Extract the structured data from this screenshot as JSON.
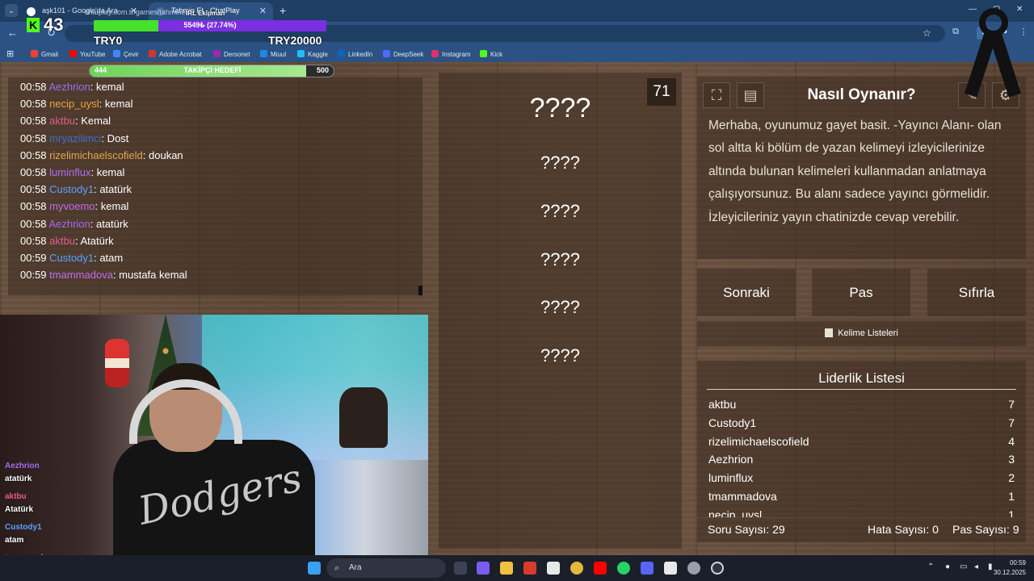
{
  "browser": {
    "tabs": [
      {
        "label": "aşk101 - Google'da Ara"
      },
      {
        "label": "Tahmin Et - ChatPlay"
      }
    ],
    "url": "chatplay.com.tr/games/tahminet",
    "bookmarks": [
      {
        "label": "Gmail",
        "color": "#ea4335"
      },
      {
        "label": "YouTube",
        "color": "#ff0000"
      },
      {
        "label": "Çevir",
        "color": "#4285f4"
      },
      {
        "label": "Adobe Acrobat",
        "color": "#d8322f"
      },
      {
        "label": "Dersonet",
        "color": "#9c27b0"
      },
      {
        "label": "Miuul",
        "color": "#1e88e5"
      },
      {
        "label": "Kaggle",
        "color": "#20beff"
      },
      {
        "label": "LinkedIn",
        "color": "#0a66c2"
      },
      {
        "label": "DeepSeek",
        "color": "#4d6bfe"
      },
      {
        "label": "Instagram",
        "color": "#e1306c"
      },
      {
        "label": "Kick",
        "color": "#53fc18"
      }
    ]
  },
  "stream": {
    "viewers": "43",
    "try_left": "TRY0",
    "try_right": "TRY20000",
    "goal_label": "5549₺ (27.74%)",
    "goal_fraction": 0.2774,
    "team_label": "IRL Ekipman",
    "follow_goal": {
      "current": "444",
      "label": "TAKİPÇİ HEDEFİ",
      "target": "500",
      "fraction": 0.888
    }
  },
  "chat": [
    {
      "time": "00:58",
      "user": "Aezhrion",
      "color": "#a36bf0",
      "msg": ": kemal"
    },
    {
      "time": "00:58",
      "user": "necip_uysl",
      "color": "#f0a23a",
      "msg": ": kemal"
    },
    {
      "time": "00:58",
      "user": "aktbu",
      "color": "#e35a8a",
      "msg": ": Kemal"
    },
    {
      "time": "00:58",
      "user": "mryazilimci",
      "color": "#3b6fd0",
      "msg": ": Dost"
    },
    {
      "time": "00:58",
      "user": "rizelimichaelscofield",
      "color": "#e3a84a",
      "msg": ": doukan"
    },
    {
      "time": "00:58",
      "user": "luminflux",
      "color": "#b26bf0",
      "msg": ": kemal"
    },
    {
      "time": "00:58",
      "user": "Custody1",
      "color": "#5aa0ff",
      "msg": ": atatürk"
    },
    {
      "time": "00:58",
      "user": "myvoemo",
      "color": "#c06ef0",
      "msg": ": kemal"
    },
    {
      "time": "00:58",
      "user": "Aezhrion",
      "color": "#a36bf0",
      "msg": ": atatürk"
    },
    {
      "time": "00:58",
      "user": "aktbu",
      "color": "#e35a8a",
      "msg": ": Atatürk"
    },
    {
      "time": "00:59",
      "user": "Custody1",
      "color": "#5aa0ff",
      "msg": ": atam"
    },
    {
      "time": "00:59",
      "user": "tmammadova",
      "color": "#c06ef0",
      "msg": ": mustafa kemal"
    }
  ],
  "game": {
    "counter": "71",
    "words": [
      "????",
      "????",
      "????",
      "????",
      "????",
      "????"
    ],
    "how_to_title": "Nasıl Oynanır?",
    "how_to_body": "Merhaba, oyunumuz gayet basit. -Yayıncı Alanı- olan sol altta ki bölüm de yazan kelimeyi izleyicilerinize altında bulunan kelimeleri kullanmadan anlatmaya çalışıyorsunuz. Bu alanı sadece yayıncı görmelidir. İzleyicileriniz yayın chatinizde cevap verebilir.",
    "buttons": {
      "next": "Sonraki",
      "pass": "Pas",
      "reset": "Sıfırla"
    },
    "word_lists": "Kelime Listeleri",
    "leaderboard_title": "Liderlik Listesi",
    "leaderboard": [
      {
        "name": "aktbu",
        "score": "7"
      },
      {
        "name": "Custody1",
        "score": "7"
      },
      {
        "name": "rizelimichaelscofield",
        "score": "4"
      },
      {
        "name": "Aezhrion",
        "score": "3"
      },
      {
        "name": "luminflux",
        "score": "2"
      },
      {
        "name": "tmammadova",
        "score": "1"
      },
      {
        "name": "necip_uysl",
        "score": "1"
      }
    ],
    "stats": {
      "questions": "Soru Sayısı: 29",
      "errors": "Hata Sayısı: 0",
      "passes": "Pas Sayısı: 9"
    }
  },
  "cam_chat": [
    {
      "user": "Aezhrion",
      "color": "#a36bf0",
      "msg": "atatürk"
    },
    {
      "user": "aktbu",
      "color": "#e35a8a",
      "msg": "Atatürk"
    },
    {
      "user": "Custody1",
      "color": "#5aa0ff",
      "msg": "atam"
    },
    {
      "user": "tmammadova",
      "color": "#c06ef0",
      "msg": "mustafa kemal"
    }
  ],
  "taskbar": {
    "search_placeholder": "Ara",
    "time": "00:59",
    "date": "30.12.2025"
  }
}
